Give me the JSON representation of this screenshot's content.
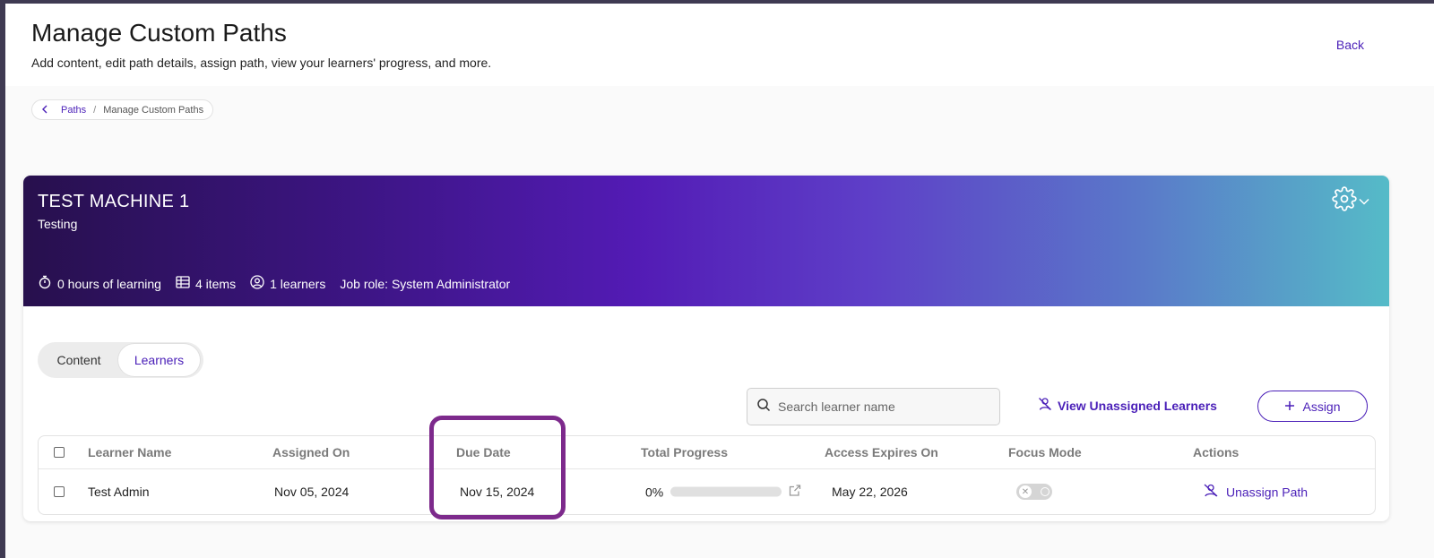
{
  "header": {
    "title": "Manage Custom Paths",
    "subtitle": "Add content, edit path details, assign path, view your learners' progress, and more.",
    "back_label": "Back"
  },
  "breadcrumb": {
    "items": [
      "Paths",
      "Manage Custom Paths"
    ]
  },
  "path": {
    "name": "TEST MACHINE 1",
    "description": "Testing",
    "hours": "0 hours of learning",
    "items": "4 items",
    "learners": "1 learners",
    "job_role": "Job role: System Administrator"
  },
  "tabs": [
    "Content",
    "Learners"
  ],
  "active_tab": "Learners",
  "search": {
    "placeholder": "Search learner name",
    "value": ""
  },
  "actions": {
    "view_unassigned": "View Unassigned Learners",
    "assign": "Assign"
  },
  "table": {
    "columns": [
      "Learner Name",
      "Assigned On",
      "Due Date",
      "Total Progress",
      "Access Expires On",
      "Focus Mode",
      "Actions"
    ],
    "rows": [
      {
        "learner_name": "Test Admin",
        "assigned_on": "Nov 05, 2024",
        "due_date": "Nov 15, 2024",
        "progress_label": "0%",
        "progress_value": 0,
        "access_expires_on": "May 22, 2026",
        "focus_mode": false,
        "action": "Unassign Path"
      }
    ]
  },
  "colors": {
    "accent": "#4a1fb8",
    "highlight": "#7d2a8c"
  }
}
